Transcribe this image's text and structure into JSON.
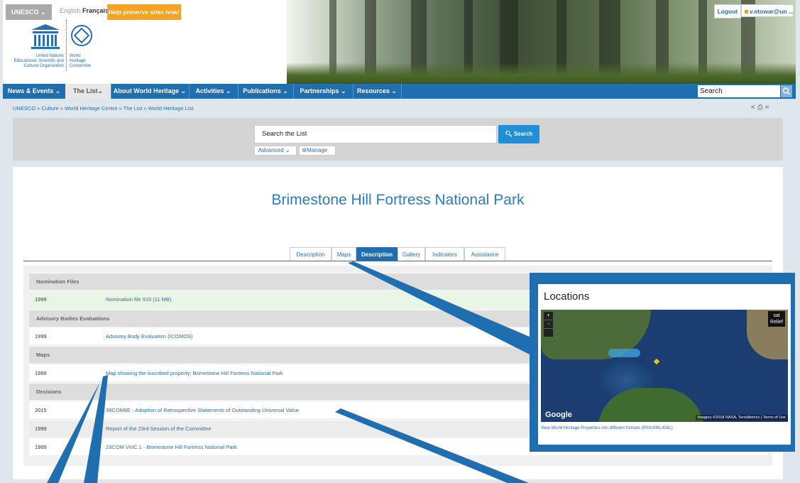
{
  "topbar": {
    "unesco_label": "UNESCO",
    "lang_en": "English",
    "lang_fr": "Français",
    "help_button": "Help preserve sites now!",
    "logout": "Logout",
    "user": "v.etowar@un ..."
  },
  "logo": {
    "org_text": "United Nations\nEducational, Scientific and\nCultural Organization",
    "whc_text": "World\nHeritage\nConvention"
  },
  "nav": {
    "items": [
      "News & Events",
      "The List",
      "About World Heritage",
      "Activities",
      "Publications",
      "Partnerships",
      "Resources"
    ],
    "search_value": "Search"
  },
  "breadcrumb": "UNESCO » Culture » World Heritage Centre » The List » World Heritage List",
  "search": {
    "placeholder": "Search the List",
    "button": "Search",
    "advanced": "Advanced",
    "manage": "Manage"
  },
  "page_title": "Brimestone Hill Fortress National Park",
  "tabs": [
    "Description",
    "Maps",
    "Description",
    "Gallery",
    "Indicators",
    "Assistance"
  ],
  "active_tab_index": 2,
  "files": {
    "nomination_head": "Nomination Files",
    "nomination": {
      "year": "1999",
      "link": "Nomination file 910 (11 MB)"
    },
    "advisory_head": "Advisory Bodies Evaluations",
    "advisory": {
      "year": "1999",
      "link": "Advisory Body Evaluation (ICOMOS)"
    },
    "maps_head": "Maps",
    "maps": {
      "year": "1999",
      "link": "Map showing the inscribed property: Brimestone Hill Fortress National Park"
    },
    "decisions_head": "Decisions",
    "decisions": [
      {
        "year": "2015",
        "link": "39COM8E - Adoption of Retrospective Statements of Outstanding Universal Value"
      },
      {
        "year": "1999",
        "link": "Report of the 23rd Session of the Committee"
      },
      {
        "year": "1999",
        "link": "23COM VIIIC.1 - Brimestone Hill Fortress National Park"
      }
    ]
  },
  "locations": {
    "title": "Locations",
    "zoom_in": "+",
    "zoom_out": "-",
    "map_type": "sat",
    "map_type2": "Relief",
    "brand": "Google",
    "credit": "Imagery ©2018 NASA, TerraMetrics | Terms of Use",
    "link": "View World Heritage Properties into different formats (RSS/XML/KML)"
  },
  "colors": {
    "nav_blue": "#1f6fb0",
    "orange": "#f5a226",
    "title_blue": "#2a7dc0"
  }
}
